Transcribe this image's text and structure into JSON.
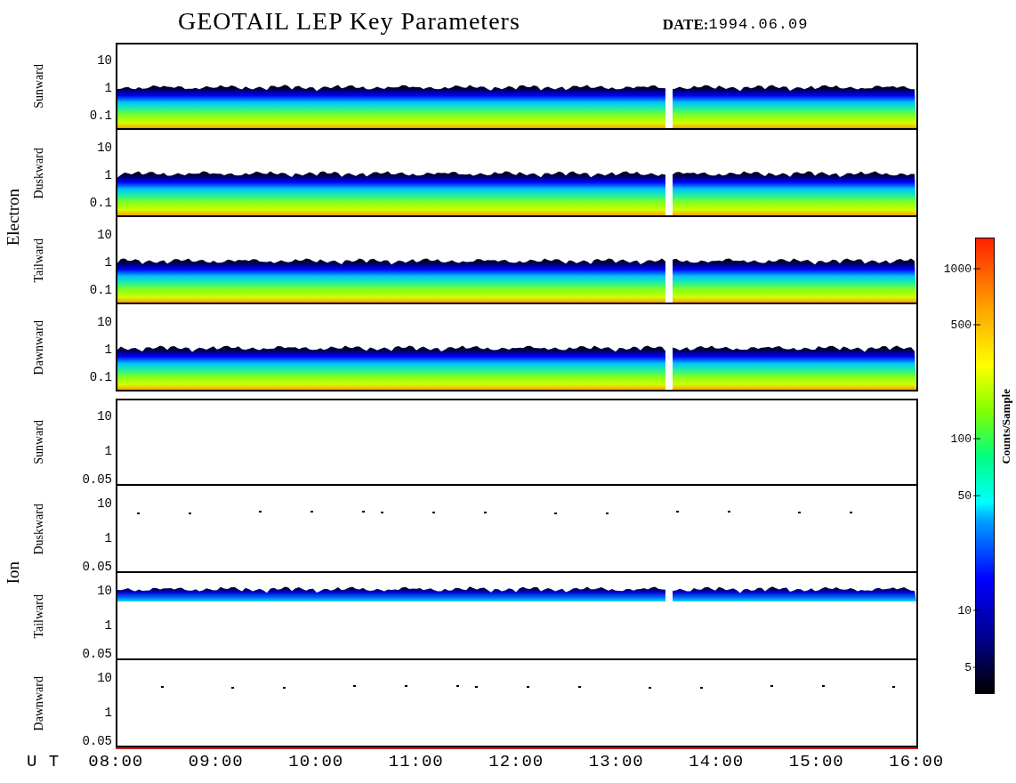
{
  "title": "GEOTAIL LEP Key Parameters",
  "date_label": "DATE:",
  "date": "1994.06.09",
  "groups": [
    {
      "label": "Electron",
      "panels": [
        {
          "label": "Sunward",
          "kind": "electron-band",
          "yticks": [
            "10",
            "1",
            "0.1"
          ]
        },
        {
          "label": "Duskward",
          "kind": "electron-band",
          "yticks": [
            "10",
            "1",
            "0.1"
          ]
        },
        {
          "label": "Tailward",
          "kind": "electron-band",
          "yticks": [
            "10",
            "1",
            "0.1"
          ]
        },
        {
          "label": "Dawnward",
          "kind": "electron-band",
          "yticks": [
            "10",
            "1",
            "0.1"
          ]
        }
      ]
    },
    {
      "label": "Ion",
      "panels": [
        {
          "label": "Sunward",
          "kind": "blank",
          "yticks": [
            "10",
            "1",
            "0.05"
          ]
        },
        {
          "label": "Duskward",
          "kind": "speckles",
          "yticks": [
            "10",
            "1",
            "0.05"
          ]
        },
        {
          "label": "Tailward",
          "kind": "ion-band",
          "yticks": [
            "10",
            "1",
            "0.05"
          ]
        },
        {
          "label": "Dawnward",
          "kind": "speckles",
          "yticks": [
            "10",
            "1",
            "0.05"
          ]
        }
      ]
    }
  ],
  "x_axis": {
    "label": "U T",
    "ticks": [
      "08:00",
      "09:00",
      "10:00",
      "11:00",
      "12:00",
      "13:00",
      "14:00",
      "15:00",
      "16:00"
    ]
  },
  "colorbar": {
    "label": "Counts/Sample",
    "ticks": [
      "1000",
      "500",
      "100",
      "50",
      "10",
      "5"
    ]
  }
}
